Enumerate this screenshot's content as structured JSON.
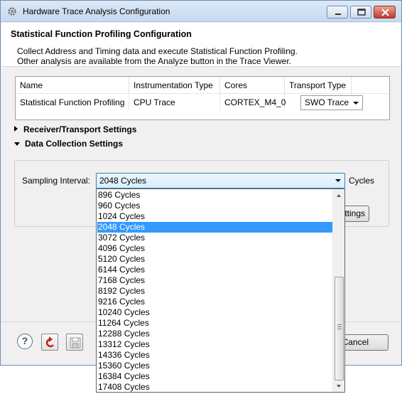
{
  "window": {
    "title": "Hardware Trace Analysis Configuration"
  },
  "header": {
    "title": "Statistical Function Profiling Configuration",
    "desc_line1": "Collect Address and Timing data and execute Statistical Function Profiling.",
    "desc_line2": "Other analysis are available from the Analyze button in the Trace Viewer."
  },
  "table": {
    "columns": [
      "Name",
      "Instrumentation Type",
      "Cores",
      "Transport Type"
    ],
    "row": {
      "name": "Statistical Function Profiling",
      "instrumentation": "CPU Trace",
      "cores": "CORTEX_M4_0",
      "transport": "SWO Trace"
    }
  },
  "sections": {
    "receiver": "Receiver/Transport Settings",
    "data_collection": "Data Collection Settings"
  },
  "sampling": {
    "label": "Sampling Interval:",
    "value": "2048 Cycles",
    "unit": "Cycles",
    "options": [
      "896 Cycles",
      "960 Cycles",
      "1024 Cycles",
      "2048 Cycles",
      "3072 Cycles",
      "4096 Cycles",
      "5120 Cycles",
      "6144 Cycles",
      "7168 Cycles",
      "8192 Cycles",
      "9216 Cycles",
      "10240 Cycles",
      "11264 Cycles",
      "12288 Cycles",
      "13312 Cycles",
      "14336 Cycles",
      "15360 Cycles",
      "16384 Cycles",
      "17408 Cycles"
    ],
    "selected_index": 3
  },
  "buttons": {
    "settings_partial": "ttings",
    "cancel_partial": "Cancel",
    "help": "?"
  },
  "icons": {
    "window": "gear-icon",
    "restore": "restore-defaults-icon",
    "save": "save-icon"
  }
}
